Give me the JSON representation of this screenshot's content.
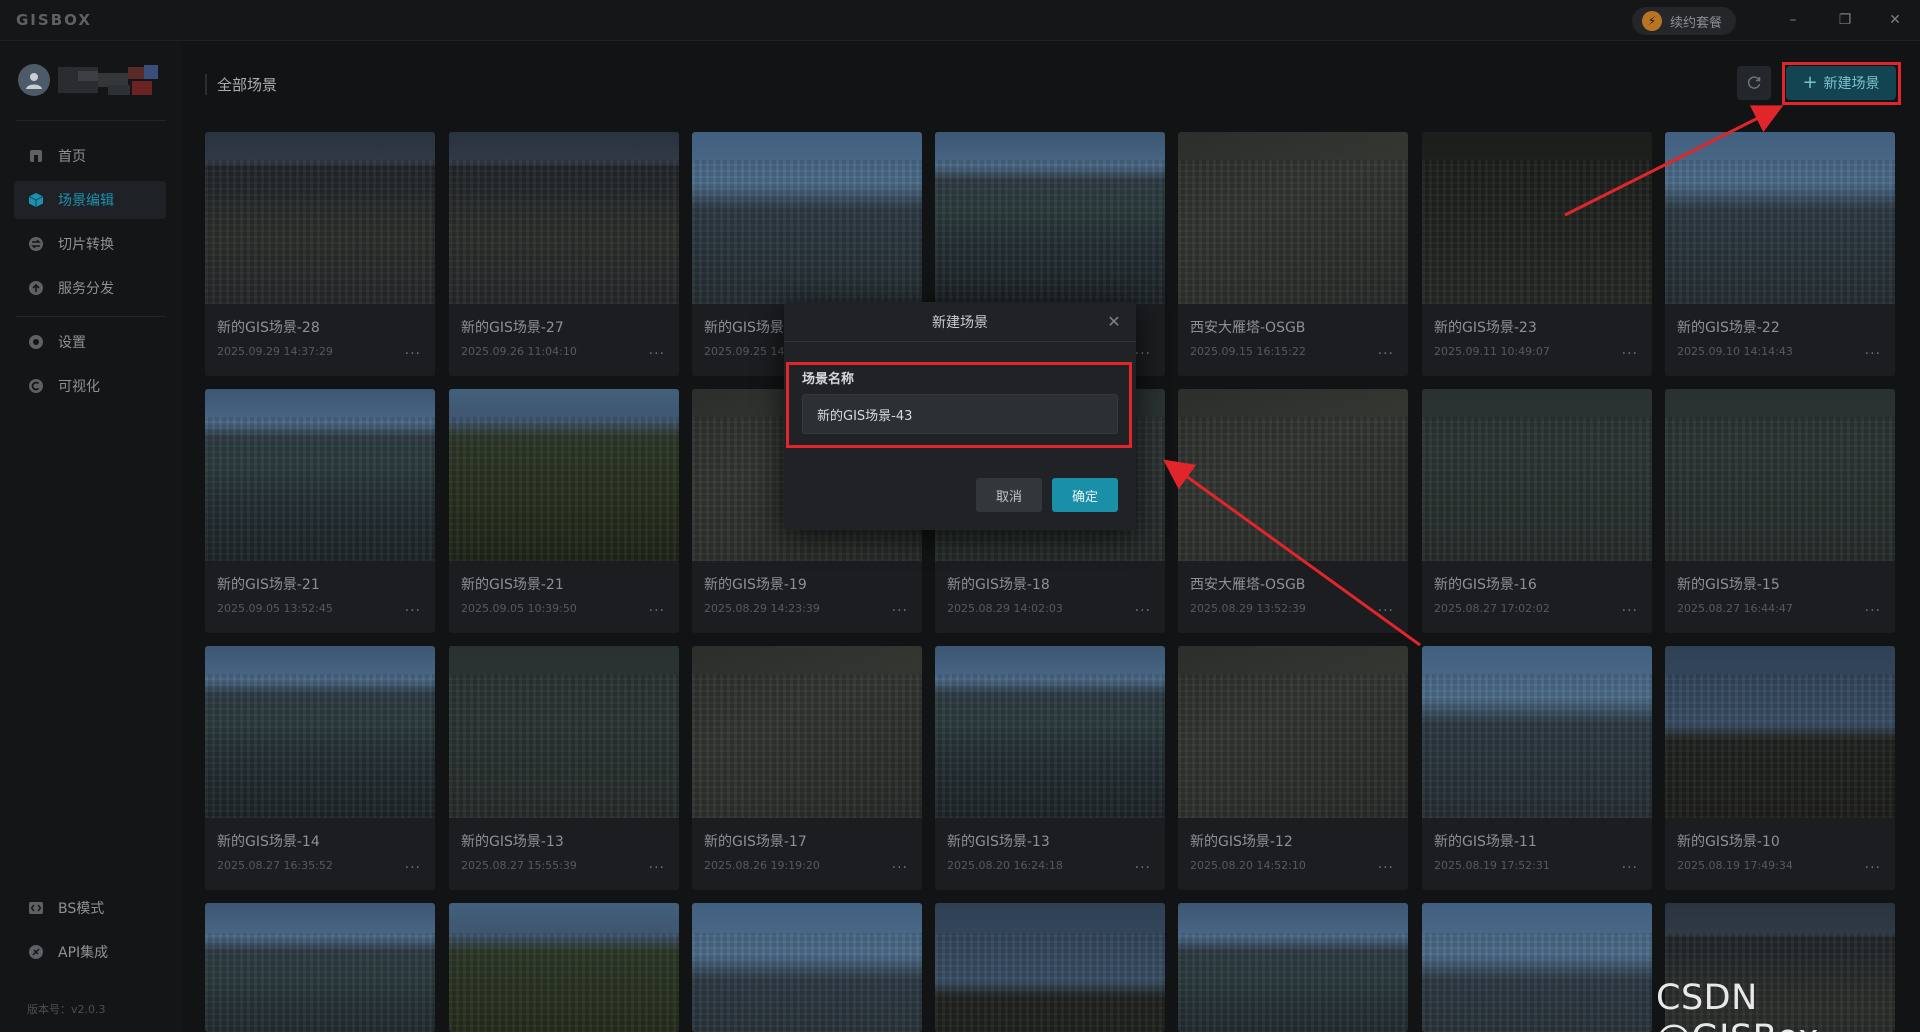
{
  "app": {
    "logo": "GISBOX",
    "renew_label": "续约套餐",
    "window_controls": [
      "minimize-icon",
      "restore-icon",
      "close-icon"
    ]
  },
  "sidebar": {
    "items": [
      {
        "label": "首页",
        "icon": "home-icon"
      },
      {
        "label": "场景编辑",
        "icon": "cube-icon",
        "active": true
      },
      {
        "label": "切片转换",
        "icon": "convert-icon"
      },
      {
        "label": "服务分发",
        "icon": "upload-icon"
      },
      {
        "label": "设置",
        "icon": "gear-icon"
      },
      {
        "label": "可视化",
        "icon": "visual-icon"
      }
    ],
    "bottom_items": [
      {
        "label": "BS模式",
        "icon": "code-icon"
      },
      {
        "label": "API集成",
        "icon": "api-icon"
      }
    ],
    "version": "版本号：v2.0.3"
  },
  "main": {
    "title": "全部场景",
    "new_scene_label": "新建场景"
  },
  "scenes": [
    {
      "name": "新的GIS场景-28",
      "date": "2025.09.29 14:37:29"
    },
    {
      "name": "新的GIS场景-27",
      "date": "2025.09.26 11:04:10"
    },
    {
      "name": "新的GIS场景",
      "date": "2025.09.25 14:"
    },
    {
      "name": "",
      "date": ""
    },
    {
      "name": "西安大雁塔-OSGB",
      "date": "2025.09.15 16:15:22"
    },
    {
      "name": "新的GIS场景-23",
      "date": "2025.09.11 10:49:07"
    },
    {
      "name": "新的GIS场景-22",
      "date": "2025.09.10 14:14:43"
    },
    {
      "name": "新的GIS场景-21",
      "date": "2025.09.05 13:52:45"
    },
    {
      "name": "新的GIS场景-21",
      "date": "2025.09.05 10:39:50"
    },
    {
      "name": "新的GIS场景-19",
      "date": "2025.08.29 14:23:39"
    },
    {
      "name": "新的GIS场景-18",
      "date": "2025.08.29 14:02:03"
    },
    {
      "name": "西安大雁塔-OSGB",
      "date": "2025.08.29 13:52:39"
    },
    {
      "name": "新的GIS场景-16",
      "date": "2025.08.27 17:02:02"
    },
    {
      "name": "新的GIS场景-15",
      "date": "2025.08.27 16:44:47"
    },
    {
      "name": "新的GIS场景-14",
      "date": "2025.08.27 16:35:52"
    },
    {
      "name": "新的GIS场景-13",
      "date": "2025.08.27 15:55:39"
    },
    {
      "name": "新的GIS场景-17",
      "date": "2025.08.26 19:19:20"
    },
    {
      "name": "新的GIS场景-13",
      "date": "2025.08.20 16:24:18"
    },
    {
      "name": "新的GIS场景-12",
      "date": "2025.08.20 14:52:10"
    },
    {
      "name": "新的GIS场景-11",
      "date": "2025.08.19 17:52:31"
    },
    {
      "name": "新的GIS场景-10",
      "date": "2025.08.19 17:49:34"
    }
  ],
  "more_label": "...",
  "dialog": {
    "title": "新建场景",
    "field_label": "场景名称",
    "field_value": "新的GIS场景-43",
    "cancel_label": "取消",
    "confirm_label": "确定"
  },
  "annotation_color": "#e0262b",
  "accent_color": "#1a8fa8",
  "watermark": "CSDN @GISBox"
}
